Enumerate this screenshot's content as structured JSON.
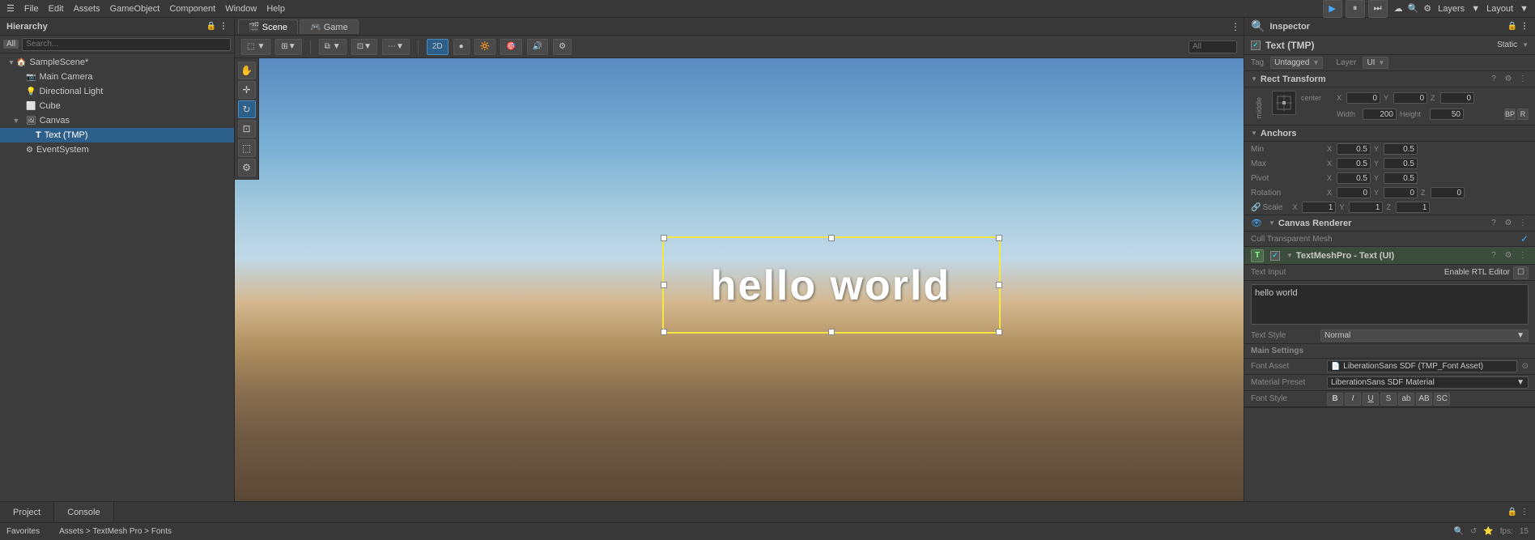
{
  "menubar": {
    "items": [
      "File",
      "Edit",
      "Assets",
      "GameObject",
      "Component",
      "Window",
      "Help"
    ]
  },
  "toolbar": {
    "play_label": "▶",
    "pause_label": "⏸",
    "step_label": "⏭",
    "layers_label": "Layers",
    "layout_label": "Layout"
  },
  "hierarchy": {
    "title": "Hierarchy",
    "all_label": "All",
    "items": [
      {
        "name": "SampleScene*",
        "indent": 0,
        "icon": "🏠",
        "hasArrow": true,
        "expanded": true
      },
      {
        "name": "Main Camera",
        "indent": 1,
        "icon": "📷",
        "hasArrow": false
      },
      {
        "name": "Directional Light",
        "indent": 1,
        "icon": "💡",
        "hasArrow": false
      },
      {
        "name": "Cube",
        "indent": 1,
        "icon": "⬜",
        "hasArrow": false
      },
      {
        "name": "Canvas",
        "indent": 1,
        "icon": "🖼",
        "hasArrow": true,
        "expanded": true
      },
      {
        "name": "Text (TMP)",
        "indent": 2,
        "icon": "T",
        "hasArrow": false,
        "selected": true
      },
      {
        "name": "EventSystem",
        "indent": 1,
        "icon": "⚙",
        "hasArrow": false
      }
    ]
  },
  "scene": {
    "scene_tab": "Scene",
    "game_tab": "Game",
    "hello_world": "hello world",
    "toolbar_items": [
      "2D",
      "●",
      "🔆",
      "📦",
      "🔊",
      "⚙"
    ]
  },
  "inspector": {
    "title": "Inspector",
    "object_name": "Text (TMP)",
    "static_label": "Static",
    "tag_label": "Tag",
    "tag_value": "Untagged",
    "layer_label": "Layer",
    "layer_value": "UI",
    "rect_transform": {
      "title": "Rect Transform",
      "anchor_label": "center",
      "middle_label": "middle",
      "pos_x_label": "Pos X",
      "pos_y_label": "Pos Y",
      "pos_z_label": "Pos Z",
      "pos_x": "0",
      "pos_y": "0",
      "pos_z": "0",
      "width_label": "Width",
      "height_label": "Height",
      "width": "200",
      "height": "50",
      "anchors_title": "Anchors",
      "min_label": "Min",
      "max_label": "Max",
      "pivot_label": "Pivot",
      "min_x": "0.5",
      "min_y": "0.5",
      "max_x": "0.5",
      "max_y": "0.5",
      "pivot_x": "0.5",
      "pivot_y": "0.5",
      "rotation_title": "Rotation",
      "rotation_x": "0",
      "rotation_y": "0",
      "rotation_z": "0",
      "scale_x": "1",
      "scale_y": "1",
      "scale_z": "1",
      "scale_label": "Scale",
      "r_label": "R",
      "bp_label": "BP"
    },
    "canvas_renderer": {
      "title": "Canvas Renderer",
      "cull_label": "Cull Transparent Mesh"
    },
    "textmeshpro": {
      "title": "TextMeshPro - Text (UI)",
      "text_input_label": "Text Input",
      "enable_rtl_label": "Enable RTL Editor",
      "text_value": "hello world",
      "text_style_label": "Text Style",
      "text_style_value": "Normal",
      "main_settings_label": "Main Settings",
      "font_asset_label": "Font Asset",
      "font_asset_value": "LiberationSans SDF (TMP_Font Asset)",
      "material_preset_label": "Material Preset",
      "material_preset_value": "LiberationSans SDF Material",
      "font_style_label": "Font Style",
      "font_style_btns": [
        "B",
        "I",
        "U",
        "S",
        "ab",
        "AB",
        "SC"
      ]
    }
  },
  "status_bar": {
    "favorites_label": "Favorites",
    "project_tab": "Project",
    "console_tab": "Console",
    "breadcrumb": "Assets > TextMesh Pro > Fonts",
    "fps": "15"
  }
}
